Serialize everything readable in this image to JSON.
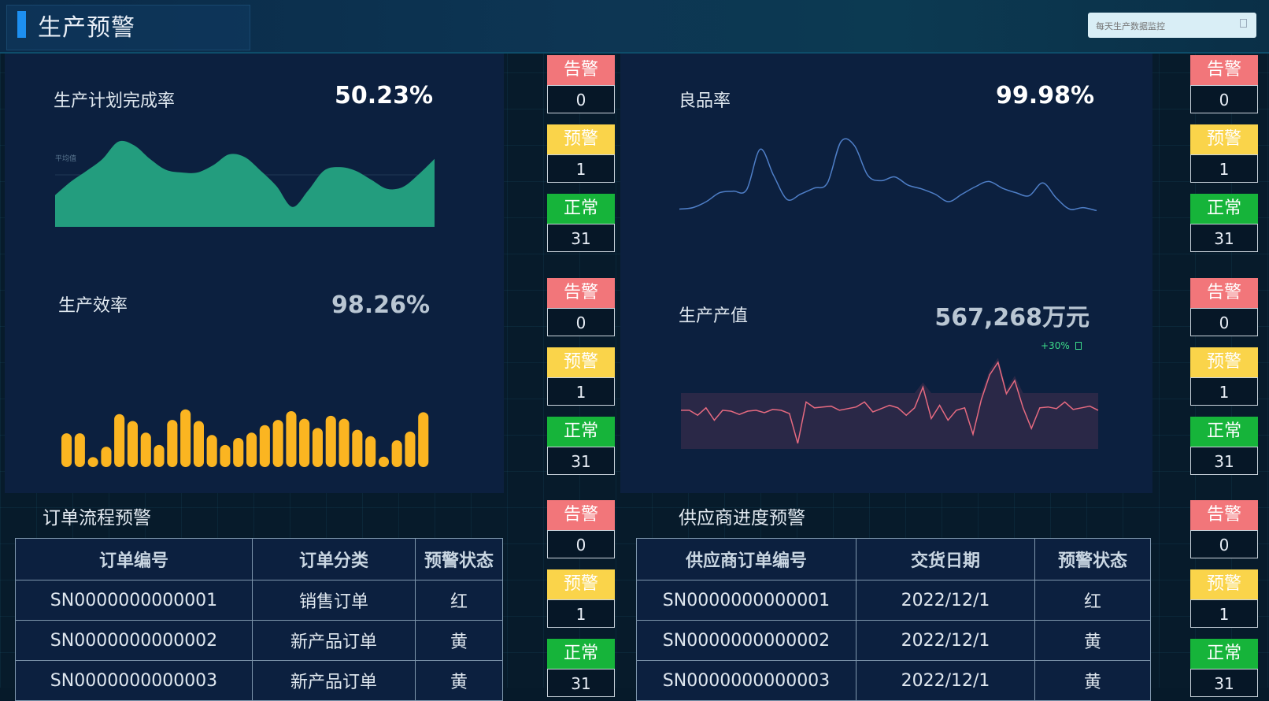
{
  "header": {
    "title": "生产预警",
    "search_placeholder": "每天生产数据监控"
  },
  "status_labels": {
    "alert": "告警",
    "warning": "预警",
    "normal": "正常"
  },
  "kpis": {
    "plan_rate": {
      "label": "生产计划完成率",
      "value": "50.23%",
      "avg_label": "平均值",
      "status": {
        "alert": "0",
        "warning": "1",
        "normal": "31"
      }
    },
    "yield_rate": {
      "label": "良品率",
      "value": "99.98%",
      "status": {
        "alert": "0",
        "warning": "1",
        "normal": "31"
      }
    },
    "efficiency": {
      "label": "生产效率",
      "value": "98.26%",
      "status": {
        "alert": "0",
        "warning": "1",
        "normal": "31"
      }
    },
    "output_value": {
      "label": "生产产值",
      "value": "567,268万元",
      "change": "+30%",
      "status": {
        "alert": "0",
        "warning": "1",
        "normal": "31"
      }
    }
  },
  "order_table": {
    "title": "订单流程预警",
    "headers": [
      "订单编号",
      "订单分类",
      "预警状态"
    ],
    "rows": [
      [
        "SN0000000000001",
        "销售订单",
        "红"
      ],
      [
        "SN0000000000002",
        "新产品订单",
        "黄"
      ],
      [
        "SN0000000000003",
        "新产品订单",
        "黄"
      ]
    ],
    "status": {
      "alert": "0",
      "warning": "1",
      "normal": "31"
    }
  },
  "supplier_table": {
    "title": "供应商进度预警",
    "headers": [
      "供应商订单编号",
      "交货日期",
      "预警状态"
    ],
    "rows": [
      [
        "SN0000000000001",
        "2022/12/1",
        "红"
      ],
      [
        "SN0000000000002",
        "2022/12/1",
        "黄"
      ],
      [
        "SN0000000000003",
        "2022/12/1",
        "黄"
      ]
    ],
    "status": {
      "alert": "0",
      "warning": "1",
      "normal": "31"
    }
  },
  "colors": {
    "alert": "#f2767a",
    "warning": "#fad44a",
    "normal": "#16b43a",
    "area": "#239d7e",
    "bar": "#fbb521",
    "yield_line": "#4f7fc8",
    "value_line": "#e66a80"
  },
  "chart_data": [
    {
      "type": "area",
      "name": "plan_rate",
      "values": [
        0.35,
        0.5,
        0.62,
        0.75,
        0.94,
        0.9,
        0.75,
        0.63,
        0.6,
        0.6,
        0.68,
        0.8,
        0.77,
        0.62,
        0.45,
        0.22,
        0.4,
        0.62,
        0.66,
        0.62,
        0.52,
        0.42,
        0.44,
        0.58,
        0.75
      ]
    },
    {
      "type": "line",
      "name": "yield_rate",
      "values": [
        0.1,
        0.12,
        0.2,
        0.32,
        0.34,
        0.36,
        0.9,
        0.55,
        0.23,
        0.3,
        0.38,
        0.45,
        1.0,
        0.95,
        0.55,
        0.48,
        0.53,
        0.42,
        0.37,
        0.3,
        0.2,
        0.3,
        0.4,
        0.47,
        0.38,
        0.32,
        0.28,
        0.45,
        0.25,
        0.1,
        0.12,
        0.08
      ]
    },
    {
      "type": "bar",
      "name": "efficiency",
      "values": [
        0.58,
        0.58,
        0.17,
        0.35,
        0.91,
        0.79,
        0.59,
        0.38,
        0.81,
        0.99,
        0.79,
        0.55,
        0.38,
        0.5,
        0.59,
        0.72,
        0.81,
        0.96,
        0.83,
        0.67,
        0.88,
        0.83,
        0.64,
        0.53,
        0.18,
        0.46,
        0.61,
        0.94
      ]
    },
    {
      "type": "line",
      "name": "output_value",
      "values": [
        0.42,
        0.42,
        0.36,
        0.45,
        0.3,
        0.42,
        0.41,
        0.37,
        0.41,
        0.42,
        0.39,
        0.43,
        0.42,
        0.38,
        0.02,
        0.52,
        0.45,
        0.46,
        0.47,
        0.42,
        0.44,
        0.46,
        0.52,
        0.4,
        0.44,
        0.48,
        0.45,
        0.36,
        0.45,
        0.7,
        0.32,
        0.48,
        0.3,
        0.42,
        0.45,
        0.13,
        0.55,
        0.85,
        1.0,
        0.62,
        0.78,
        0.45,
        0.2,
        0.45,
        0.46,
        0.44,
        0.52,
        0.43,
        0.45,
        0.47,
        0.42
      ]
    }
  ]
}
